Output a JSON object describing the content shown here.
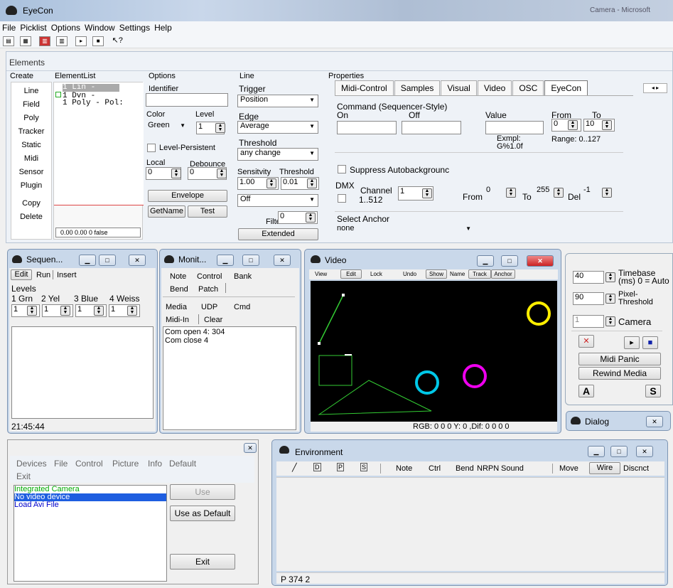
{
  "window": {
    "title": "EyeCon",
    "right_title": "Camera - Microsoft"
  },
  "menu": [
    "File",
    "Picklist",
    "Options",
    "Window",
    "Settings",
    "Help"
  ],
  "elements_panel": {
    "title": "Elements",
    "headers": {
      "create": "Create",
      "list": "ElementList",
      "options": "Options",
      "line": "Line",
      "properties": "Properties"
    },
    "create_items": [
      "Line",
      "Field",
      "Poly",
      "Tracker",
      "Static",
      "Midi",
      "Sensor",
      "Plugin"
    ],
    "create_copy": "Copy",
    "create_delete": "Delete",
    "element_list": [
      "1 Lin  -",
      "1 Dvn  -",
      "1 Poly  - Pol:"
    ],
    "list_status": "0.00 0.00 0 false",
    "options": {
      "identifier": "Identifier",
      "color_label": "Color",
      "level_label": "Level",
      "color_value": "Green",
      "level_value": "1",
      "level_persistent": "Level-Persistent",
      "local_label": "Local",
      "debounce_label": "Debounce",
      "local_value": "0",
      "debounce_value": "0",
      "envelope": "Envelope",
      "get_name": "GetName",
      "test": "Test"
    },
    "line": {
      "trigger_label": "Trigger",
      "trigger_value": "Position",
      "edge_label": "Edge",
      "edge_value": "Average",
      "threshold_label": "Threshold",
      "threshold_value": "any change",
      "sensitivity_label": "Sensitvity",
      "threshold2_label": "Threshold",
      "sensitivity_value": "1.00",
      "threshold2_value": "0.01",
      "off_value": "Off",
      "filter_label": "Filter",
      "filter_value": "0",
      "extended": "Extended"
    },
    "properties": {
      "tabs": [
        "Midi-Control",
        "Samples",
        "Visual",
        "Video",
        "OSC",
        "EyeCon"
      ],
      "command_label": "Command (Sequencer-Style)",
      "on_label": "On",
      "off_label": "Off",
      "value_label": "Value",
      "from_label": "From",
      "to_label": "To",
      "from_value": "0",
      "to_value": "10",
      "example": "Exmpl:\nG%1.0f",
      "range": "Range: 0..127",
      "suppress": "Suppress Autobackgrounc",
      "dmx_label": "DMX",
      "channel_label": "Channel",
      "channel_range": "1..512",
      "channel_value": "1",
      "dmx_from_label": "From",
      "dmx_from_value": "0",
      "dmx_to_label": "To",
      "dmx_to_value": "255",
      "del_label": "Del",
      "del_value": "-1",
      "anchor_label": "Select Anchor",
      "anchor_value": "none"
    }
  },
  "sequencer": {
    "title": "Sequen...",
    "tabs": [
      "Edit",
      "Run",
      "Insert"
    ],
    "levels_label": "Levels",
    "level_names": [
      "1 Grn",
      "2 Yel",
      "3 Blue",
      "4 Weiss"
    ],
    "level_values": [
      "1",
      "1",
      "1",
      "1"
    ],
    "time": "21:45:44"
  },
  "monitor": {
    "title": "Monit...",
    "row1": [
      "Note",
      "Control",
      "Bank"
    ],
    "row2": [
      "Bend",
      "Patch"
    ],
    "row3": [
      "Media",
      "UDP",
      "Cmd"
    ],
    "row4": [
      "Midi-In",
      "Clear"
    ],
    "log": [
      "Com open 4: 304",
      "Com close 4"
    ]
  },
  "video": {
    "title": "Video",
    "toolbar": [
      "View",
      "Edit",
      "Lock",
      "Undo",
      "Show",
      "Name",
      "Track",
      "Anchor"
    ],
    "status": "RGB: 0 0 0  Y: 0 ,Dif: 0 0 0 0",
    "colors": {
      "line": "#33cc33",
      "yellow": "#ffee00",
      "cyan": "#00c8e8",
      "magenta": "#ee00ee"
    }
  },
  "control": {
    "timebase_value": "40",
    "timebase_label": "Timebase\n(ms) 0 = Auto",
    "pixel_value": "90",
    "pixel_label": "Pixel-\nThreshold",
    "camera_value": "1",
    "camera_label": "Camera",
    "midi_panic": "Midi Panic",
    "rewind_media": "Rewind Media",
    "a_label": "A",
    "s_label": "S"
  },
  "dialog": {
    "title": "Dialog"
  },
  "devices": {
    "menu1": [
      "Devices",
      "File",
      "Control",
      "Picture",
      "Info",
      "Default"
    ],
    "menu2": [
      "Exit"
    ],
    "list": [
      "Integrated Camera",
      "No video device",
      "Load Avi File"
    ],
    "use": "Use",
    "use_default": "Use as Default",
    "exit": "Exit"
  },
  "environment": {
    "title": "Environment",
    "tools": [
      "Note",
      "Ctrl",
      "Bend",
      "NRPN",
      "Sound"
    ],
    "tabs": [
      "Move",
      "Wire",
      "Discnct"
    ],
    "status": "P 374 2"
  }
}
